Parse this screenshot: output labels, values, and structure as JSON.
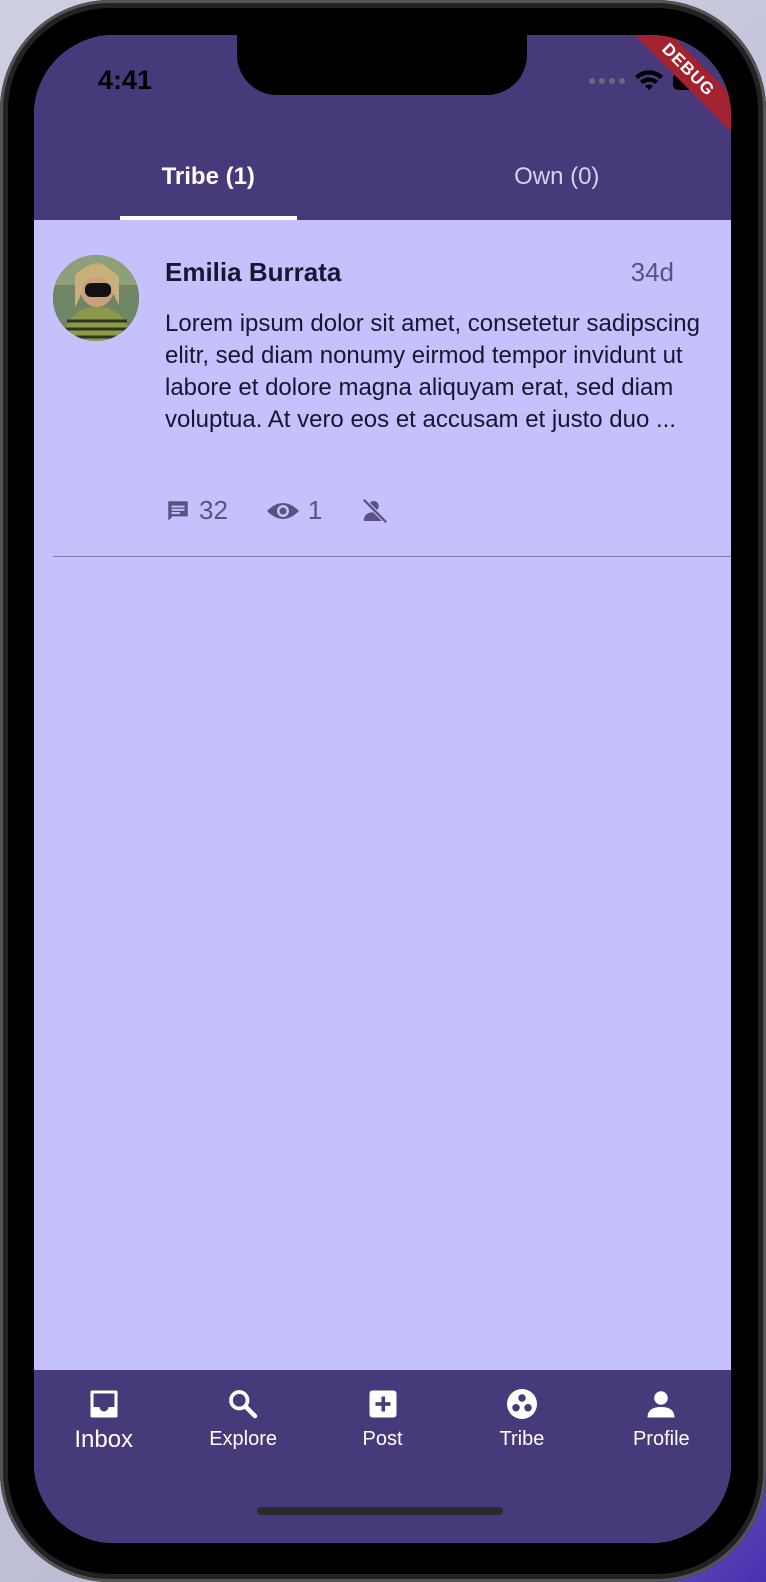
{
  "status_bar": {
    "time": "4:41",
    "debug_label": "DEBUG"
  },
  "tabs": [
    {
      "label": "Tribe (1)",
      "active": true
    },
    {
      "label": "Own (0)",
      "active": false
    }
  ],
  "posts": [
    {
      "author": "Emilia Burrata",
      "age": "34d",
      "body": "Lorem ipsum dolor sit amet, consetetur sadipscing elitr, sed diam nonumy eirmod tempor invidunt ut labore et dolore magna aliquyam erat, sed diam voluptua. At vero eos et accusam et justo duo ...",
      "comments": "32",
      "views": "1",
      "icons": [
        "comment-icon",
        "eye-icon",
        "person-off-icon"
      ]
    }
  ],
  "bottom_nav": [
    {
      "label": "Inbox",
      "icon": "inbox-icon",
      "active": true
    },
    {
      "label": "Explore",
      "icon": "search-icon",
      "active": false
    },
    {
      "label": "Post",
      "icon": "add-box-icon",
      "active": false
    },
    {
      "label": "Tribe",
      "icon": "tribe-icon",
      "active": false
    },
    {
      "label": "Profile",
      "icon": "person-icon",
      "active": false
    }
  ],
  "colors": {
    "app_bar": "#473a7b",
    "background": "#c4c1fd",
    "debug_ribbon": "#a3222f"
  }
}
